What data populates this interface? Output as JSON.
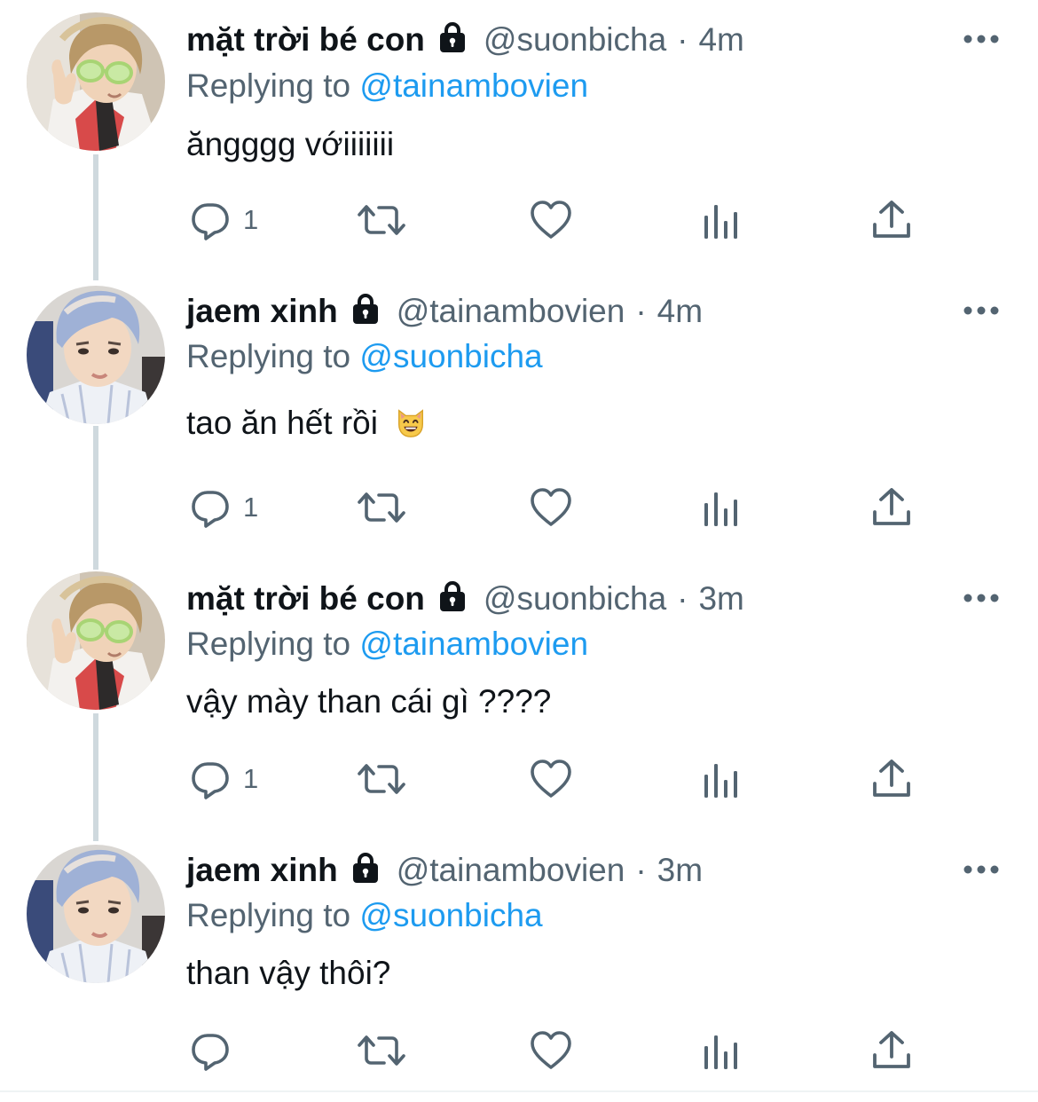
{
  "tweets": [
    {
      "name": "mặt trời bé con",
      "handle": "@suonbicha",
      "dot": "·",
      "time": "4m",
      "reply_prefix": "Replying to",
      "reply_to": "@tainambovien",
      "text": "ăngggg vớiiiiiii",
      "reply_count": "1",
      "avatar": "avatar-sunglasses"
    },
    {
      "name": "jaem xinh",
      "handle": "@tainambovien",
      "dot": "·",
      "time": "4m",
      "reply_prefix": "Replying to",
      "reply_to": "@suonbicha",
      "text": "tao ăn hết rồi",
      "emoji": "grinning-cat-emoji",
      "reply_count": "1",
      "avatar": "avatar-blue-hair"
    },
    {
      "name": "mặt trời bé con",
      "handle": "@suonbicha",
      "dot": "·",
      "time": "3m",
      "reply_prefix": "Replying to",
      "reply_to": "@tainambovien",
      "text": "vậy mày than cái gì ????",
      "reply_count": "1",
      "avatar": "avatar-sunglasses"
    },
    {
      "name": "jaem xinh",
      "handle": "@tainambovien",
      "dot": "·",
      "time": "3m",
      "reply_prefix": "Replying to",
      "reply_to": "@suonbicha",
      "text": "than vậy thôi?",
      "reply_count": "",
      "avatar": "avatar-blue-hair"
    }
  ],
  "icons": {
    "lock": "lock-icon",
    "more": "more-icon",
    "reply": "reply-icon",
    "retweet": "retweet-icon",
    "like": "heart-icon",
    "analytics": "analytics-icon",
    "share": "share-icon"
  },
  "colors": {
    "name": "#0f1419",
    "secondary": "#536471",
    "link": "#1d9bf0",
    "thread_line": "#cfd9de",
    "icon": "#536471"
  }
}
